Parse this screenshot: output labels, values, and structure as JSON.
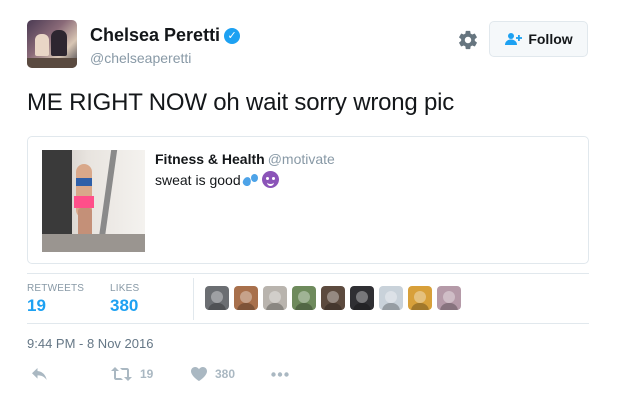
{
  "author": {
    "name": "Chelsea Peretti",
    "handle": "@chelseaperetti",
    "verified_icon": "verified-badge-icon"
  },
  "header": {
    "settings_icon": "gear-icon",
    "follow_label": "Follow",
    "follow_icon": "add-user-icon"
  },
  "tweet": {
    "text": "ME RIGHT NOW oh wait sorry wrong pic",
    "timestamp": "9:44 PM - 8 Nov 2016"
  },
  "quoted": {
    "name": "Fitness & Health",
    "handle": "@motivate",
    "text": "sweat is good",
    "emojis": [
      "sweat-droplets-emoji",
      "smiling-devil-emoji"
    ]
  },
  "stats": {
    "retweets_label": "RETWEETS",
    "retweets_value": "19",
    "likes_label": "LIKES",
    "likes_value": "380"
  },
  "likers": [
    {
      "color": "#6b6e72"
    },
    {
      "color": "#a8704c"
    },
    {
      "color": "#b9b4ae"
    },
    {
      "color": "#6e8a5c"
    },
    {
      "color": "#5c4a3e"
    },
    {
      "color": "#2f2f33"
    },
    {
      "color": "#c9d2da"
    },
    {
      "color": "#d8a03a"
    },
    {
      "color": "#b59aa8"
    }
  ],
  "actions": {
    "reply_icon": "reply-icon",
    "retweet_icon": "retweet-icon",
    "retweet_count": "19",
    "like_icon": "heart-icon",
    "like_count": "380",
    "more_icon": "more-icon"
  },
  "colors": {
    "accent": "#1da1f2",
    "muted": "#8899a6",
    "icon": "#aab8c2"
  }
}
